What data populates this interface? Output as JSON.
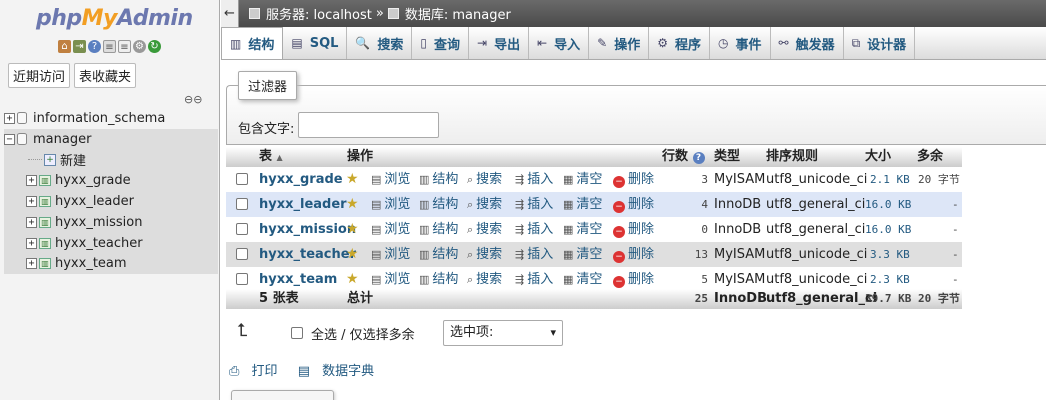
{
  "logo": {
    "php": "php",
    "my": "My",
    "admin": "Admin"
  },
  "sidebar": {
    "tabs": [
      "近期访问",
      "表收藏夹"
    ],
    "icons": [
      "home-icon",
      "exit-icon",
      "help-icon",
      "docs-icon",
      "docs2-icon",
      "settings-icon",
      "reload-icon"
    ],
    "tree": [
      {
        "label": "information_schema",
        "kind": "db",
        "expander": "+"
      },
      {
        "label": "manager",
        "kind": "db",
        "expander": "−",
        "selected": true
      },
      {
        "label": "新建",
        "kind": "new"
      },
      {
        "label": "hyxx_grade",
        "kind": "table",
        "expander": "+"
      },
      {
        "label": "hyxx_leader",
        "kind": "table",
        "expander": "+"
      },
      {
        "label": "hyxx_mission",
        "kind": "table",
        "expander": "+"
      },
      {
        "label": "hyxx_teacher",
        "kind": "table",
        "expander": "+"
      },
      {
        "label": "hyxx_team",
        "kind": "table",
        "expander": "+"
      }
    ]
  },
  "breadcrumb": {
    "server": "服务器: localhost",
    "sep": "»",
    "db": "数据库: manager"
  },
  "tabs": [
    {
      "label": "结构",
      "icon": "structure-icon",
      "glyph": "▥",
      "active": true
    },
    {
      "label": "SQL",
      "icon": "sql-icon",
      "glyph": "▤"
    },
    {
      "label": "搜索",
      "icon": "search-icon",
      "glyph": "🔍"
    },
    {
      "label": "查询",
      "icon": "query-icon",
      "glyph": "▯"
    },
    {
      "label": "导出",
      "icon": "export-icon",
      "glyph": "⇥"
    },
    {
      "label": "导入",
      "icon": "import-icon",
      "glyph": "⇤"
    },
    {
      "label": "操作",
      "icon": "wrench-icon",
      "glyph": "✎"
    },
    {
      "label": "程序",
      "icon": "routines-icon",
      "glyph": "⚙"
    },
    {
      "label": "事件",
      "icon": "events-icon",
      "glyph": "◷"
    },
    {
      "label": "触发器",
      "icon": "triggers-icon",
      "glyph": "⚯"
    },
    {
      "label": "设计器",
      "icon": "designer-icon",
      "glyph": "⧉"
    }
  ],
  "filter": {
    "legend": "过滤器",
    "label": "包含文字:",
    "value": ""
  },
  "table": {
    "headers": {
      "table": "表",
      "sort": "▲",
      "action": "操作",
      "rows": "行数",
      "type": "类型",
      "collation": "排序规则",
      "size": "大小",
      "overhead": "多余"
    },
    "actions": {
      "browse": "浏览",
      "structure": "结构",
      "search": "搜索",
      "insert": "插入",
      "empty": "清空",
      "drop": "删除"
    },
    "rows": [
      {
        "name": "hyxx_grade",
        "rows": "3",
        "type": "MyISAM",
        "collation": "utf8_unicode_ci",
        "size": "2.1 KB",
        "overhead": "20 字节"
      },
      {
        "name": "hyxx_leader",
        "rows": "4",
        "type": "InnoDB",
        "collation": "utf8_general_ci",
        "size": "16.0 KB",
        "overhead": "-"
      },
      {
        "name": "hyxx_mission",
        "rows": "0",
        "type": "InnoDB",
        "collation": "utf8_general_ci",
        "size": "16.0 KB",
        "overhead": "-"
      },
      {
        "name": "hyxx_teacher",
        "rows": "13",
        "type": "MyISAM",
        "collation": "utf8_unicode_ci",
        "size": "3.3 KB",
        "overhead": "-"
      },
      {
        "name": "hyxx_team",
        "rows": "5",
        "type": "MyISAM",
        "collation": "utf8_unicode_ci",
        "size": "2.3 KB",
        "overhead": "-"
      }
    ],
    "footer": {
      "count": "5 张表",
      "sum": "总计",
      "rows": "25",
      "type": "InnoDB",
      "collation": "utf8_general_ci",
      "size": "39.7 KB",
      "overhead": "20 字节"
    }
  },
  "bulk": {
    "check_all": "全选 / 仅选择多余",
    "with_selected": "选中项:"
  },
  "footer_links": {
    "print": "打印",
    "dict": "数据字典"
  }
}
